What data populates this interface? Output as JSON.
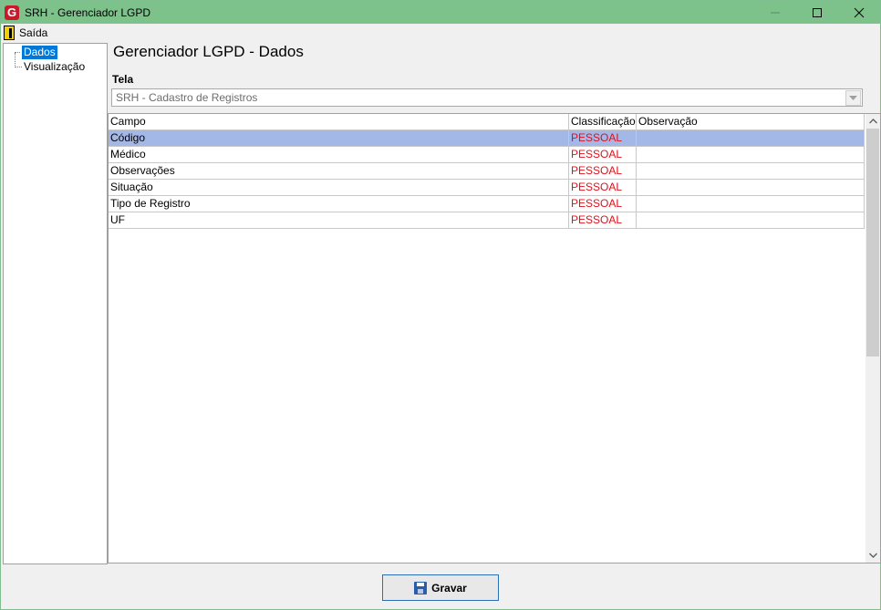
{
  "window": {
    "title": "SRH - Gerenciador LGPD",
    "app_icon_letter": "G"
  },
  "menu": {
    "exit_label": "Saída"
  },
  "tree": {
    "items": [
      {
        "label": "Dados",
        "selected": true
      },
      {
        "label": "Visualização",
        "selected": false
      }
    ]
  },
  "main": {
    "heading": "Gerenciador LGPD - Dados",
    "tela_label": "Tela",
    "tela_value": "SRH - Cadastro de Registros"
  },
  "grid": {
    "headers": [
      "Campo",
      "Classificação",
      "Observação"
    ],
    "rows": [
      {
        "campo": "Código",
        "classificacao": "PESSOAL",
        "observacao": ""
      },
      {
        "campo": "Médico",
        "classificacao": "PESSOAL",
        "observacao": ""
      },
      {
        "campo": "Observações",
        "classificacao": "PESSOAL",
        "observacao": ""
      },
      {
        "campo": "Situação",
        "classificacao": "PESSOAL",
        "observacao": ""
      },
      {
        "campo": "Tipo de Registro",
        "classificacao": "PESSOAL",
        "observacao": ""
      },
      {
        "campo": "UF",
        "classificacao": "PESSOAL",
        "observacao": ""
      }
    ],
    "selected_row": 0
  },
  "footer": {
    "gravar_label": "Gravar"
  },
  "colors": {
    "titlebar": "#7cc28a",
    "selection": "#a4b8e8",
    "classification_text": "#e0101a",
    "tree_selection": "#0078d7"
  }
}
